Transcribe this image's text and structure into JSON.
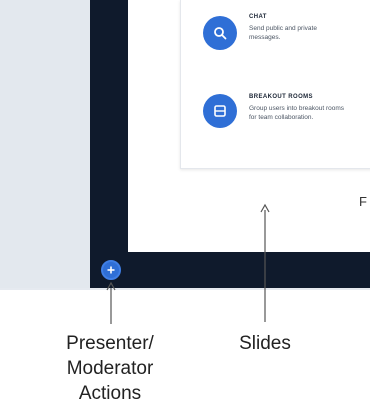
{
  "features": [
    {
      "title": "CHAT",
      "description": "Send public and private messages.",
      "icon": "chat-search-icon"
    },
    {
      "title": "BREAKOUT ROOMS",
      "description": "Group users into breakout rooms for team collaboration.",
      "icon": "breakout-room-icon"
    }
  ],
  "edge_letter": "F",
  "presenter_button_icon": "plus-icon",
  "labels": {
    "presenter_line1": "Presenter/",
    "presenter_line2": "Moderator",
    "presenter_line3": "Actions",
    "slides": "Slides"
  },
  "colors": {
    "frame": "#0f1a2c",
    "accent": "#2f6fd6",
    "background": "#e6eaf0"
  }
}
